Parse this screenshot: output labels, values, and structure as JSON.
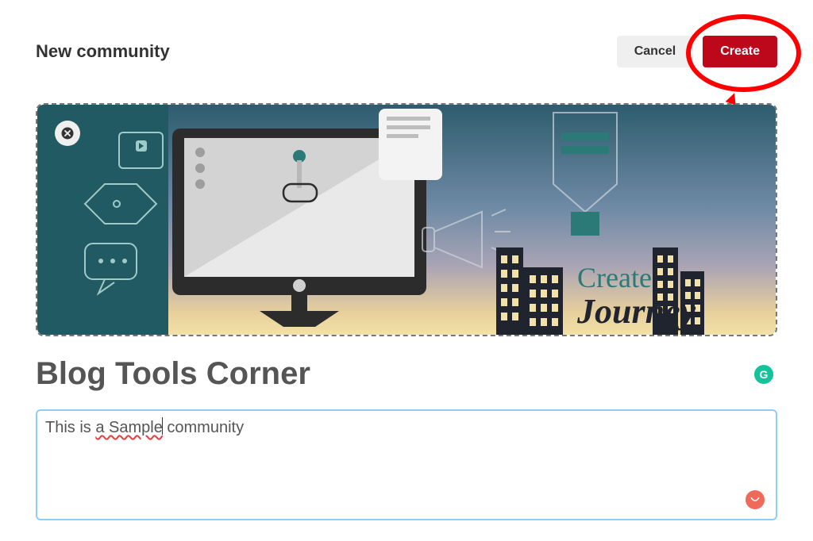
{
  "header": {
    "title": "New community",
    "cancel_label": "Cancel",
    "create_label": "Create"
  },
  "community": {
    "name_value": "Blog Tools Corner"
  },
  "description": {
    "prefix": "This is ",
    "spellcheck_phrase": "a Sample",
    "suffix": " community"
  },
  "cover": {
    "brand_line1": "Create",
    "brand_line2": "Journey"
  },
  "icons": {
    "close": "close-icon",
    "grammarly": "G",
    "emoji": "smile"
  },
  "colors": {
    "accent_red": "#bd081c",
    "grammarly_green": "#15C39A",
    "emoji_orange": "#EF6A5A",
    "highlight_red": "#ff0000",
    "focus_border": "#8ecdf7"
  }
}
